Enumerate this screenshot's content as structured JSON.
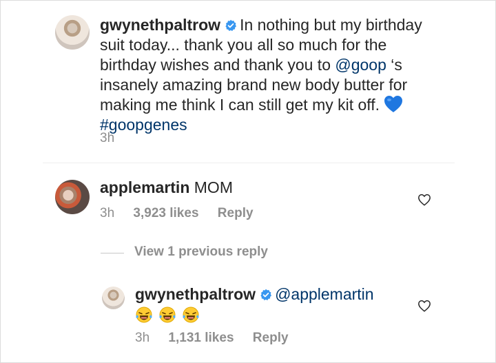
{
  "post": {
    "username": "gwynethpaltrow",
    "caption_part1": "In nothing but my birthday suit today... thank you all so much for the birthday wishes and thank you to ",
    "mention": "@goop",
    "caption_part2": " ‘s insanely amazing brand new body butter for making me think I can still get my kit off.",
    "hashtag": "#goopgenes",
    "time": "3h"
  },
  "comments": [
    {
      "username": "applemartin",
      "text": "MOM",
      "time": "3h",
      "likes": "3,923 likes",
      "reply_label": "Reply"
    }
  ],
  "view_replies_label": "View 1 previous reply",
  "reply": {
    "username": "gwynethpaltrow",
    "mention": "@applemartin",
    "emoji": [
      "face-with-tears-of-joy",
      "face-with-tears-of-joy",
      "face-with-tears-of-joy"
    ],
    "time": "3h",
    "likes": "1,131 likes",
    "reply_label": "Reply"
  },
  "colors": {
    "verified": "#3897f0",
    "link": "#003569",
    "meta": "#8e8e8e",
    "heart_emoji": "#1f77e0"
  }
}
